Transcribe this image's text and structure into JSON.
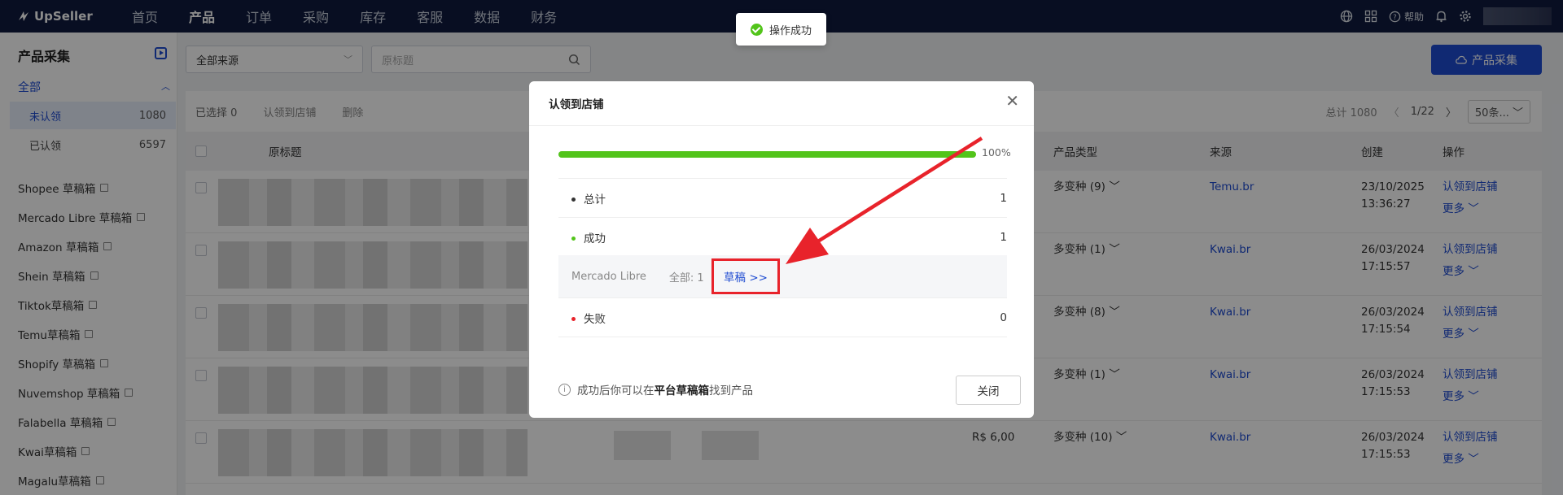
{
  "app": {
    "logo": "UpSeller"
  },
  "nav": [
    "首页",
    "产品",
    "订单",
    "采购",
    "库存",
    "客服",
    "数据",
    "财务"
  ],
  "nav_active": 1,
  "top_right": {
    "help": "帮助"
  },
  "sidebar": {
    "title": "产品采集",
    "all_label": "全部",
    "filters": [
      {
        "label": "未认领",
        "count": "1080"
      },
      {
        "label": "已认领",
        "count": "6597"
      }
    ],
    "links": [
      "Shopee 草稿箱",
      "Mercado Libre 草稿箱",
      "Amazon 草稿箱",
      "Shein 草稿箱",
      "Tiktok草稿箱",
      "Temu草稿箱",
      "Shopify 草稿箱",
      "Nuvemshop 草稿箱",
      "Falabella 草稿箱",
      "Kwai草稿箱",
      "Magalu草稿箱"
    ]
  },
  "filter": {
    "source": "全部来源",
    "search_placeholder": "原标题"
  },
  "collect_button": "产品采集",
  "toolbar": {
    "selected": "已选择 0",
    "claim": "认领到店铺",
    "delete": "删除"
  },
  "pager": {
    "total": "总计 1080",
    "page": "1/22",
    "page_size": "50条..."
  },
  "columns": {
    "title": "原标题",
    "type": "产品类型",
    "source": "来源",
    "created": "创建",
    "action": "操作"
  },
  "rows": [
    {
      "type": "多变种 (9)",
      "source": "Temu.br",
      "date": "23/10/2025",
      "time": "13:36:27",
      "price": ""
    },
    {
      "type": "多变种 (1)",
      "source": "Kwai.br",
      "date": "26/03/2024",
      "time": "17:15:57",
      "price": ""
    },
    {
      "type": "多变种 (8)",
      "source": "Kwai.br",
      "date": "26/03/2024",
      "time": "17:15:54",
      "price": ""
    },
    {
      "type": "多变种 (1)",
      "source": "Kwai.br",
      "date": "26/03/2024",
      "time": "17:15:53",
      "price": ""
    },
    {
      "type": "多变种 (10)",
      "source": "Kwai.br",
      "date": "26/03/2024",
      "time": "17:15:53",
      "price": "R$ 6,00"
    }
  ],
  "row_actions": {
    "claim": "认领到店铺",
    "more": "更多"
  },
  "toast": "操作成功",
  "modal": {
    "title": "认领到店铺",
    "progress": 100,
    "progress_label": "100%",
    "total_label": "总计",
    "total_value": "1",
    "success_label": "成功",
    "success_value": "1",
    "platform": "Mercado Libre",
    "platform_all": "全部: 1",
    "draft_link": "草稿 >>",
    "fail_label": "失败",
    "fail_value": "0",
    "note_prefix": "成功后你可以在",
    "note_bold": "平台草稿箱",
    "note_suffix": "找到产品",
    "close_button": "关闭"
  },
  "colors": {
    "primary": "#1e4bd1",
    "topbar": "#0f1b3e",
    "success": "#52c41a",
    "danger": "#e8232b",
    "highlight": "#e8232b"
  }
}
